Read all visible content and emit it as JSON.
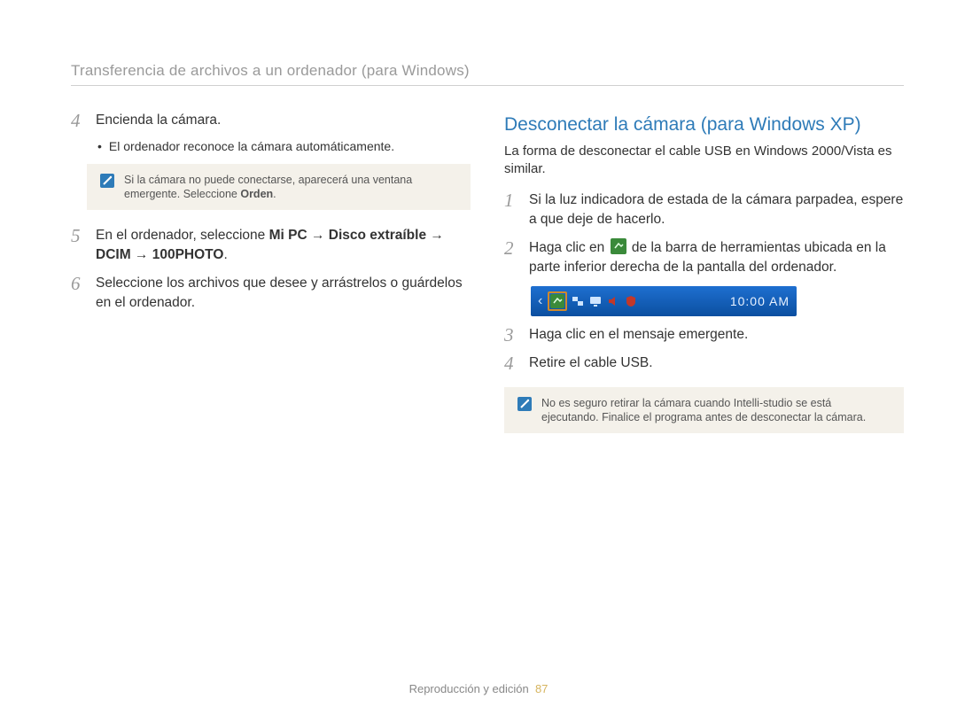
{
  "header": {
    "title": "Transferencia de archivos a un ordenador (para Windows)"
  },
  "left": {
    "step4": {
      "num": "4",
      "text": "Encienda la cámara.",
      "sub": "El ordenador reconoce la cámara automáticamente."
    },
    "note1": {
      "text_a": "Si la cámara no puede conectarse, aparecerá una ventana emergente. Seleccione ",
      "text_b": "Orden",
      "text_c": "."
    },
    "step5": {
      "num": "5",
      "intro": "En el ordenador, seleccione ",
      "path1": "Mi PC",
      "arrow": " → ",
      "path2": "Disco extraíble",
      "path3": "DCIM",
      "path4": "100PHOTO",
      "end": "."
    },
    "step6": {
      "num": "6",
      "text": "Seleccione los archivos que desee y arrástrelos o guárdelos en el ordenador."
    }
  },
  "right": {
    "heading": "Desconectar la cámara (para Windows XP)",
    "lead": "La forma de desconectar el cable USB en Windows 2000/Vista es similar.",
    "step1": {
      "num": "1",
      "text": "Si la luz indicadora de estada de la cámara parpadea, espere a que deje de hacerlo."
    },
    "step2": {
      "num": "2",
      "text_a": "Haga clic en ",
      "text_b": " de la barra de herramientas ubicada en la parte inferior derecha de la pantalla del ordenador."
    },
    "tray": {
      "time": "10:00 AM"
    },
    "step3": {
      "num": "3",
      "text": "Haga clic en el mensaje emergente."
    },
    "step4": {
      "num": "4",
      "text": "Retire el cable USB."
    },
    "note2": {
      "text": "No es seguro retirar la cámara cuando Intelli-studio se está ejecutando. Finalice el programa antes de desconectar la cámara."
    }
  },
  "footer": {
    "text": "Reproducción y edición",
    "page": "87"
  }
}
